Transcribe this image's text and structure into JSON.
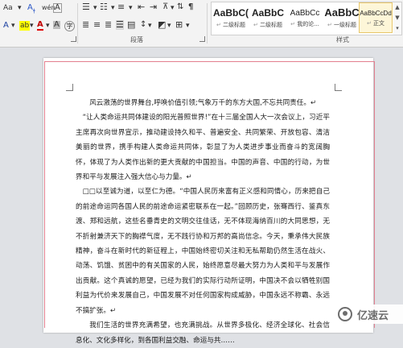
{
  "ribbon": {
    "font_group": {
      "aa_change_case": "Aa",
      "text_effect": "A",
      "highlight": "ab",
      "font_color": "A",
      "char_shading": "A",
      "enclose_char": "字"
    },
    "paragraph_group_label": "段落",
    "styles_group_label": "样式",
    "styles": [
      {
        "preview": "AaBbC(",
        "name": "二级标题"
      },
      {
        "preview": "AaBbC",
        "name": "二级标题"
      },
      {
        "preview": "AaBbCc",
        "name": "我的论..."
      },
      {
        "preview": "AaBbC",
        "name": "一级标题"
      },
      {
        "preview": "AaBbCcDd",
        "name": "正文"
      }
    ],
    "gallery_up": "▲",
    "gallery_down": "▼",
    "gallery_more": "▾"
  },
  "document": {
    "paragraphs": [
      "风云激荡的世界舞台,呼唤价值引领;气象万千的东方大国,不忘共同责任。↵",
      "“让人类命运共同体建设的阳光普照世界!”在十三届全国人大一次会议上，习近平主席再次向世界宣示，推动建设持久和平、普遍安全、共同繁荣、开放包容、清洁美丽的世界，携手构建人类命运共同体，彰显了为人类进步事业而奋斗的宽阔胸怀，体现了为人类作出新的更大贡献的中国担当。中国的声音、中国的行动，为世界和平与发展注入强大信心与力量。↵",
      "□□以至诚为道，以至仁为德。“中国人民历来富有正义感和同情心，历来把自己的前途命运同各国人民的前途命运紧密联系在一起。”回顾历史，张骞西行、鉴真东渡、郑和远航，这些名垂青史的文明交往佳话，无不体现海纳百川的大同思想，无不折射兼济天下的胸襟气度，无不践行协和万邦的高尚信念。今天，秉承伟大民族精神，奋斗在新时代的新征程上，中国始终密切关注和无私帮助仍然生活在战火、动荡、饥饿、贫困中的有关国家的人民，始终愿意尽最大努力为人类和平与发展作出贡献。这个真诚的愿望，已经为我们的实际行动所证明，中国决不会以牺牲别国利益为代价来发展自己，中国发展不对任何国家构成威胁，中国永远不称霸、永远不搞扩张。↵",
      "我们生活的世界充满希望，也充满挑战。从世界多极化、经济全球化、社会信息化、文化多样化，到各国利益交融、命运与共……"
    ]
  },
  "watermark": {
    "text": "亿速云"
  },
  "colors": {
    "margin_line": "#e37f8f",
    "ribbon_bg": "#f3f3f3",
    "canvas_bg": "#dfe1e5"
  }
}
